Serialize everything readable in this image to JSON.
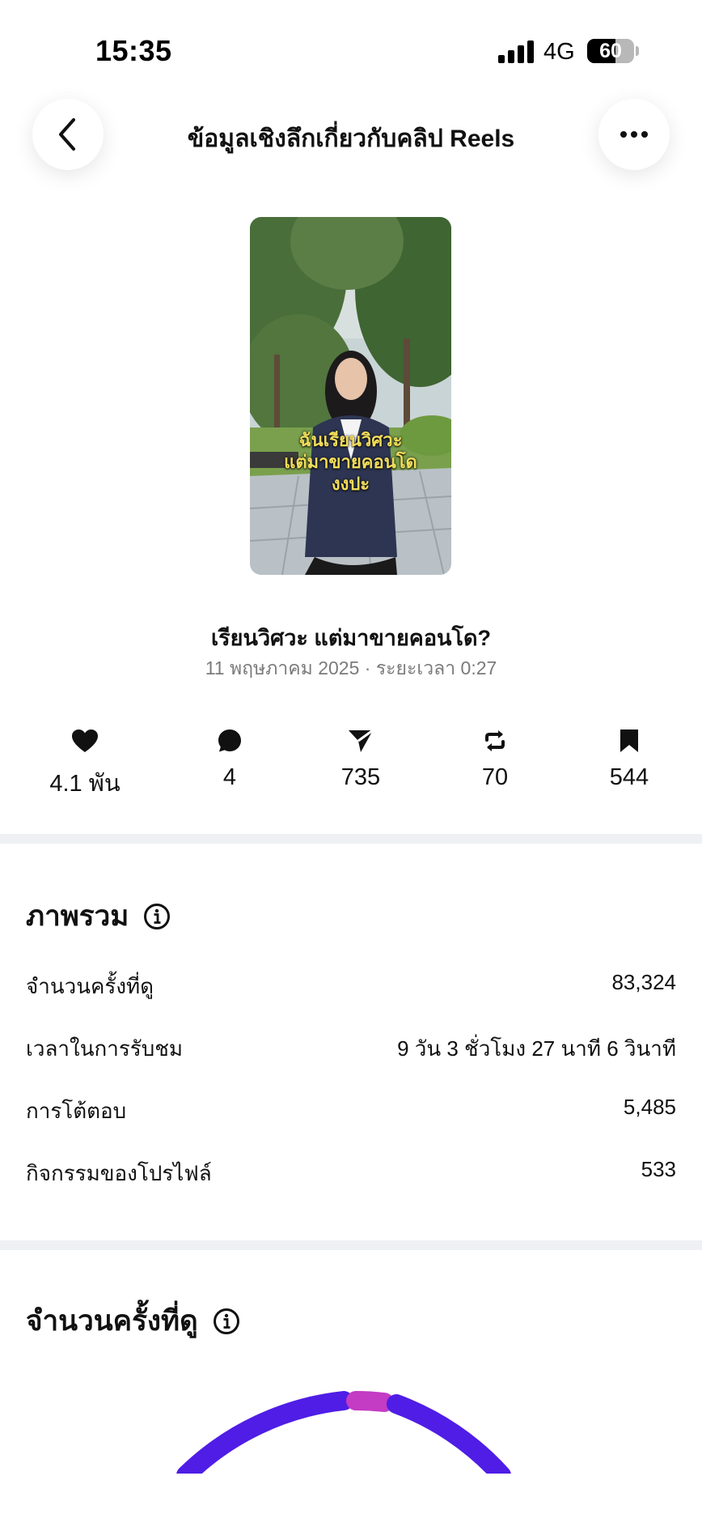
{
  "status_bar": {
    "time": "15:35",
    "network": "4G",
    "battery": "60",
    "battery_level": 0.6
  },
  "header": {
    "title": "ข้อมูลเชิงลึกเกี่ยวกับคลิป Reels",
    "back_icon": "chevron-left-icon",
    "more_icon": "ellipsis-icon"
  },
  "reel": {
    "thumbnail_caption_line1": "ฉันเรียนวิศวะ",
    "thumbnail_caption_line2": "แต่มาขายคอนโด",
    "thumbnail_caption_line3": "งงปะ",
    "title": "เรียนวิศวะ แต่มาขายคอนโด?",
    "meta": "11 พฤษภาคม  2025 · ระยะเวลา 0:27"
  },
  "stats": {
    "likes": "4.1 พัน",
    "comments": "4",
    "shares": "735",
    "reposts": "70",
    "saves": "544"
  },
  "overview": {
    "title": "ภาพรวม",
    "rows": [
      {
        "label": "จำนวนครั้งที่ดู",
        "value": "83,324"
      },
      {
        "label": "เวลาในการรับชม",
        "value": "9 วัน 3 ชั่วโมง 27 นาที 6 วินาที"
      },
      {
        "label": "การโต้ตอบ",
        "value": "5,485"
      },
      {
        "label": "กิจกรรมของโปรไฟล์",
        "value": "533"
      }
    ]
  },
  "views_section": {
    "title": "จำนวนครั้งที่ดู"
  },
  "colors": {
    "accent_purple": "#4f1de6",
    "accent_magenta": "#c43bc4",
    "divider": "#eff0f3",
    "muted_text": "#7b7b7b"
  }
}
